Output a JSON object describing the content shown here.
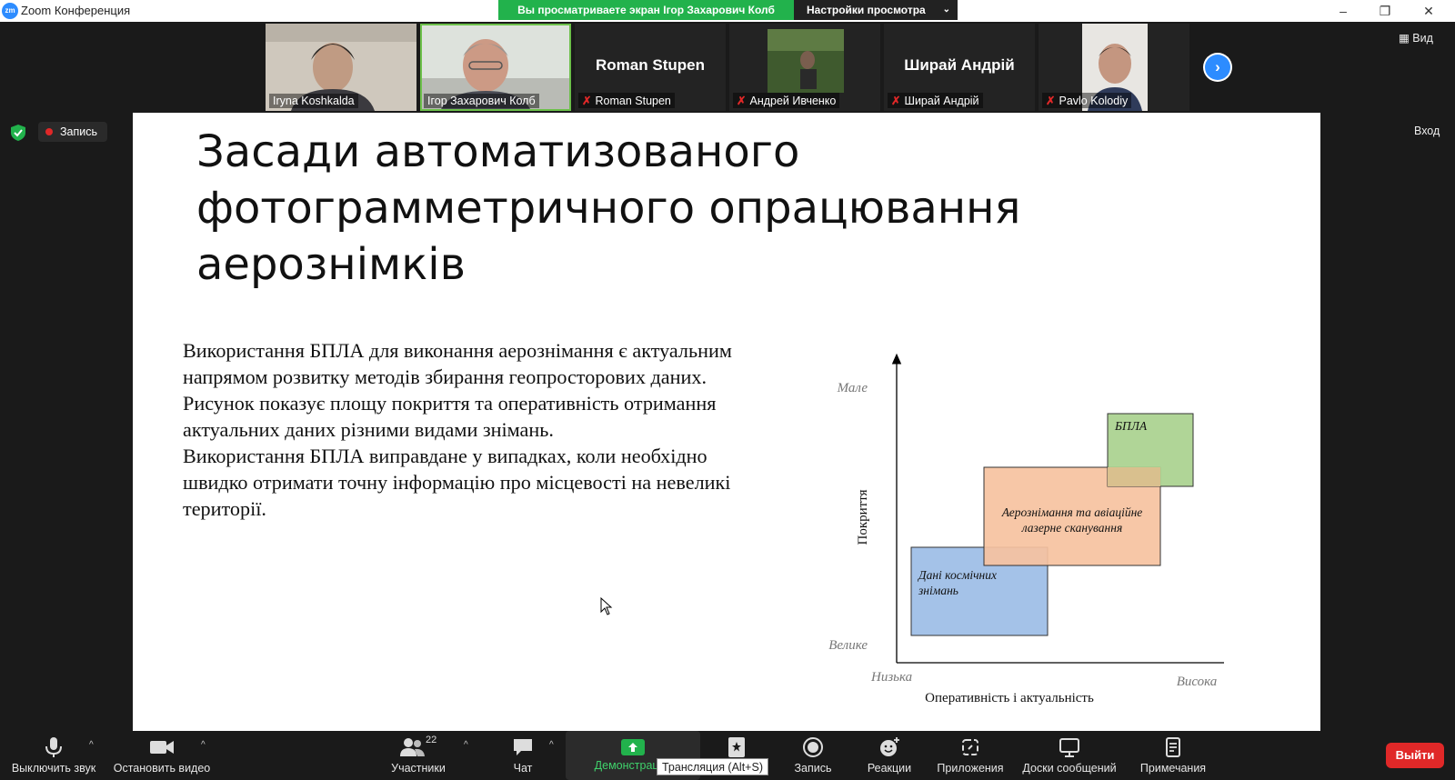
{
  "window": {
    "title": "Zoom Конференция",
    "logo_text": "zm",
    "share_banner": "Вы просматриваете экран Ігор Захарович Колб",
    "view_options": "Настройки просмотра",
    "view_button": "Вид",
    "enter_button": "Вход"
  },
  "participants": [
    {
      "name": "Iryna Koshkalda",
      "muted": false,
      "video": true
    },
    {
      "name": "Ігор Захарович Колб",
      "muted": false,
      "video": true,
      "active": true
    },
    {
      "name": "Roman Stupen",
      "muted": true,
      "video": false
    },
    {
      "name": "Андрей Ивченко",
      "muted": true,
      "video": true
    },
    {
      "name": "Ширай Андрій",
      "muted": true,
      "video": false
    },
    {
      "name": "Pavlo Kolodiy",
      "muted": true,
      "video": true
    }
  ],
  "recording": {
    "label": "Запись"
  },
  "slide": {
    "title": "Засади автоматизованого фотограмметричного опрацювання аерознімків",
    "paragraph1": "Використання БПЛА для виконання аерознімання є актуальним напрямом розвитку методів збирання геопросторових даних. Рисунок показує площу покриття та оперативність отримання актуальних даних різними видами знімань.",
    "paragraph2": "Використання БПЛА виправдане у випадках, коли необхідно швидко отримати точну інформацію про місцевості на невеликі території."
  },
  "chart_data": {
    "type": "diagram",
    "xlabel": "Оперативність і актуальність",
    "ylabel": "Покриття",
    "x_low": "Низька",
    "x_high": "Висока",
    "y_top": "Мале",
    "y_bottom": "Велике",
    "regions": [
      {
        "label": "Дані космічних знімань",
        "color": "#a4c2e8"
      },
      {
        "label": "Аерознімання та авіаційне лазерне сканування",
        "color": "#f6c2a0"
      },
      {
        "label": "БПЛА",
        "color": "#a9d18e"
      }
    ]
  },
  "toolbar": {
    "mute": "Выключить звук",
    "video": "Остановить видео",
    "participants": "Участники",
    "participants_count": "22",
    "chat": "Чат",
    "share": "Демонстрация",
    "tooltip": "Трансляция (Alt+S)",
    "record": "Запись",
    "reactions": "Реакции",
    "apps": "Приложения",
    "whiteboards": "Доски сообщений",
    "notes": "Примечания",
    "leave": "Выйти"
  },
  "colors": {
    "accent": "#2d8cff",
    "share_green": "#22b24c",
    "leave_red": "#e02828"
  }
}
